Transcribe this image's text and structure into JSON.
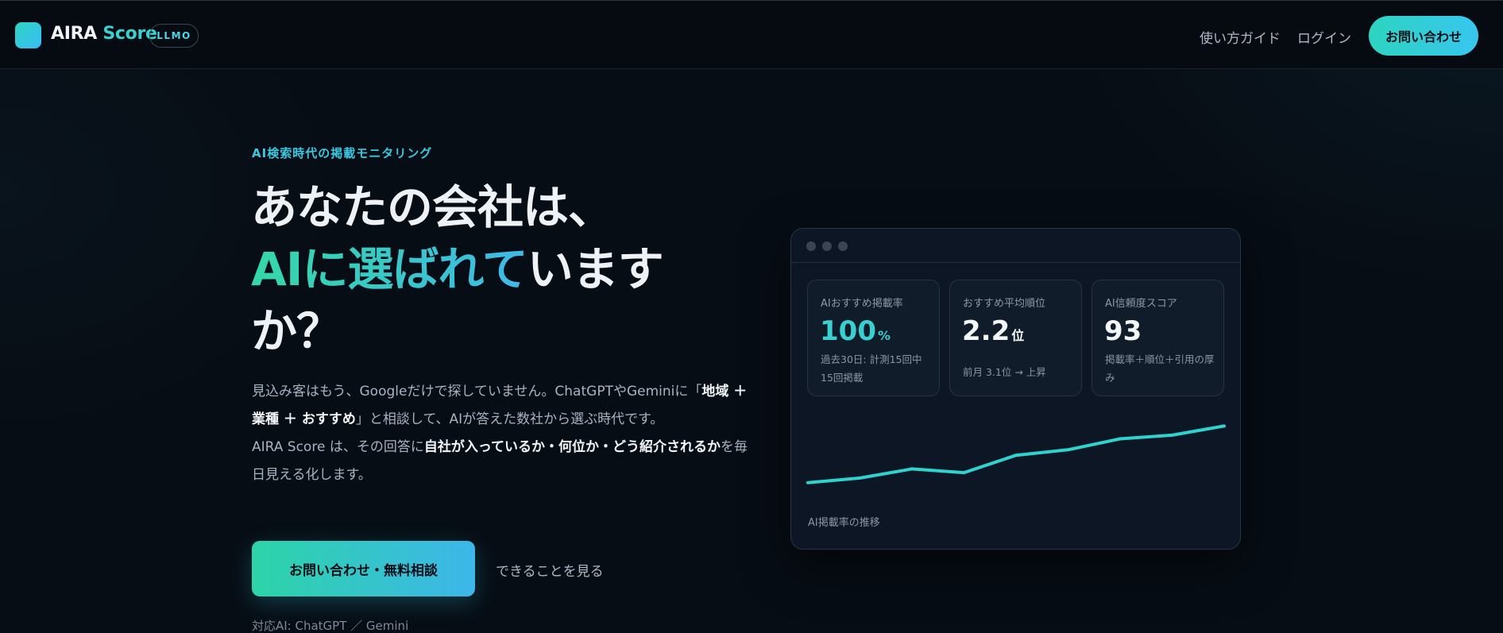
{
  "header": {
    "brand_main": "AIRA",
    "brand_accent": "Score",
    "badge": "LLMO",
    "nav": {
      "guide": "使い方ガイド",
      "login": "ログイン"
    },
    "cta": "お問い合わせ"
  },
  "hero": {
    "eyebrow": "AI検索時代の掲載モニタリング",
    "headline_line1": "あなたの会社は、",
    "headline_accent": "AIに選ばれて",
    "headline_line2_rest": "います",
    "headline_line3": "か？",
    "desc_p1_a": "見込み客はもう、Googleだけで探していません。ChatGPTやGeminiに「",
    "desc_p1_strong": "地域 ＋ 業種 ＋ おすすめ",
    "desc_p1_b": "」と相談して、AIが答えた数社から選ぶ時代です。",
    "desc_p2_a": "AIRA Score は、その回答に",
    "desc_p2_strong": "自社が入っているか・何位か・どう紹介されるか",
    "desc_p2_b": "を毎日見える化します。",
    "cta_primary": "お問い合わせ・無料相談",
    "cta_secondary": "できることを見る",
    "supported": "対応AI: ChatGPT ／ Gemini"
  },
  "dashboard": {
    "metrics": [
      {
        "label": "AIおすすめ掲載率",
        "value": "100",
        "unit": "%",
        "sub": "過去30日: 計測15回中15回掲載"
      },
      {
        "label": "おすすめ平均順位",
        "value": "2.2",
        "unit": "位",
        "sub": "前月 3.1位 → 上昇"
      },
      {
        "label": "AI信頼度スコア",
        "value": "93",
        "unit": "",
        "sub": "掲載率＋順位＋引用の厚み"
      }
    ],
    "chart_caption": "AI掲載率の推移"
  },
  "chart_data": {
    "type": "line",
    "title": "",
    "xlabel": "",
    "ylabel": "",
    "x": [
      1,
      2,
      3,
      4,
      5,
      6,
      7,
      8,
      9
    ],
    "series": [
      {
        "values": [
          22,
          27,
          37,
          33,
          52,
          58,
          70,
          74,
          84
        ]
      }
    ],
    "ylim": [
      0,
      100
    ],
    "grid": false,
    "color": "#2ed3cf"
  },
  "colors": {
    "background": "#070d15",
    "accent_teal": "#3ad0cf",
    "accent_blue": "#38c6f0",
    "card": "#0c1624"
  }
}
